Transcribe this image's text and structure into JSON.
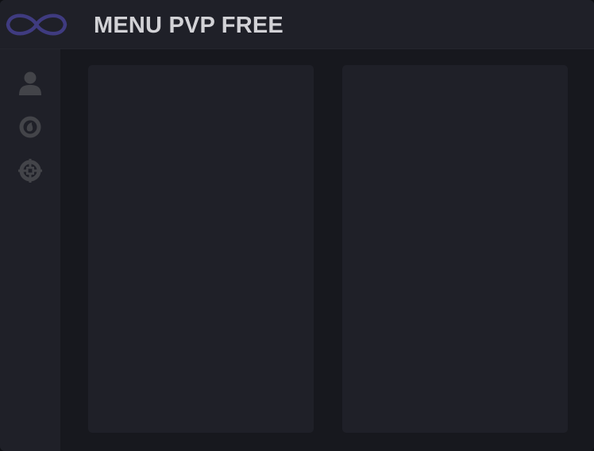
{
  "header": {
    "title": "MENU PVP FREE",
    "logo_icon": "infinity-icon",
    "logo_color": "#3f3b80"
  },
  "sidebar": {
    "items": [
      {
        "icon": "user-icon"
      },
      {
        "icon": "eye-icon"
      },
      {
        "icon": "crosshair-icon"
      }
    ],
    "icon_color": "#434449"
  },
  "colors": {
    "background": "#17181e",
    "panel": "#1f2028",
    "title_text": "#d2d2d6"
  }
}
